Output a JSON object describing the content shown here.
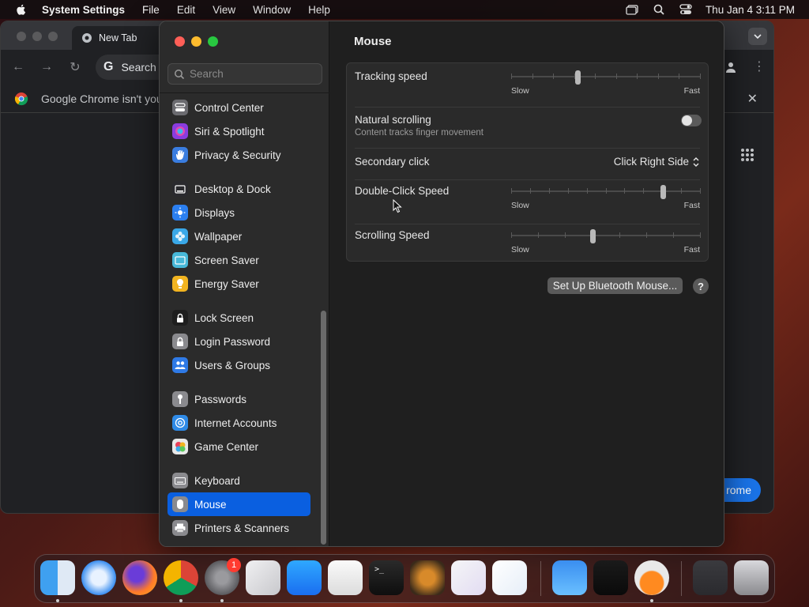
{
  "menubar": {
    "app_name": "System Settings",
    "items": [
      "File",
      "Edit",
      "View",
      "Window",
      "Help"
    ],
    "clock": "Thu Jan 4  3:11 PM"
  },
  "chrome": {
    "tab_title": "New Tab",
    "omnibox_text": "Search",
    "infobar_text": "Google Chrome isn't you",
    "cta_text": "rome"
  },
  "settings": {
    "search_placeholder": "Search",
    "sidebar": [
      {
        "label": "Control Center",
        "icon": "control-center-icon",
        "color": "#6b6b70"
      },
      {
        "label": "Siri & Spotlight",
        "icon": "siri-icon",
        "color": "#8a3ce0"
      },
      {
        "label": "Privacy & Security",
        "icon": "hand-icon",
        "color": "#3a7de0"
      },
      {
        "label": "Desktop & Dock",
        "icon": "desktop-icon",
        "color": "#2a2a2e"
      },
      {
        "label": "Displays",
        "icon": "sun-icon",
        "color": "#2b7ff0"
      },
      {
        "label": "Wallpaper",
        "icon": "flower-icon",
        "color": "#3aa8e8"
      },
      {
        "label": "Screen Saver",
        "icon": "screensaver-icon",
        "color": "#47b8d8"
      },
      {
        "label": "Energy Saver",
        "icon": "bulb-icon",
        "color": "#f2b420"
      },
      {
        "label": "Lock Screen",
        "icon": "lock-icon",
        "color": "#1e1e1e"
      },
      {
        "label": "Login Password",
        "icon": "padlock-icon",
        "color": "#8a8a8e"
      },
      {
        "label": "Users & Groups",
        "icon": "users-icon",
        "color": "#2f7ae6"
      },
      {
        "label": "Passwords",
        "icon": "key-icon",
        "color": "#8a8a8e"
      },
      {
        "label": "Internet Accounts",
        "icon": "at-icon",
        "color": "#2f8ae6"
      },
      {
        "label": "Game Center",
        "icon": "game-center-icon",
        "color": "#e8e8e8"
      },
      {
        "label": "Keyboard",
        "icon": "keyboard-icon",
        "color": "#8a8a8e"
      },
      {
        "label": "Mouse",
        "icon": "mouse-icon",
        "color": "#8a8a8e",
        "selected": true
      },
      {
        "label": "Printers & Scanners",
        "icon": "printer-icon",
        "color": "#8a8a8e"
      }
    ],
    "page_title": "Mouse",
    "tracking": {
      "label": "Tracking speed",
      "min": "Slow",
      "max": "Fast",
      "value": 0.35
    },
    "natural": {
      "label": "Natural scrolling",
      "sub": "Content tracks finger movement",
      "on": false
    },
    "secondary": {
      "label": "Secondary click",
      "value": "Click Right Side"
    },
    "doubleclick": {
      "label": "Double-Click Speed",
      "min": "Slow",
      "max": "Fast",
      "value": 0.8
    },
    "scrolling": {
      "label": "Scrolling Speed",
      "min": "Slow",
      "max": "Fast",
      "value": 0.43
    },
    "bluetooth_button": "Set Up Bluetooth Mouse...",
    "help": "?"
  },
  "dock": {
    "apps": [
      "finder-icon",
      "safari-icon",
      "firefox-icon",
      "chrome-icon",
      "system-settings-icon",
      "launchpad-icon",
      "app-store-icon",
      "textedit-icon",
      "terminal-icon",
      "garageband-icon",
      "visual-studio-icon",
      "vscode-icon",
      "weather-icon",
      "activity-monitor-icon",
      "potion-icon",
      "preview-icon",
      "trash-icon"
    ],
    "settings_badge": "1"
  }
}
